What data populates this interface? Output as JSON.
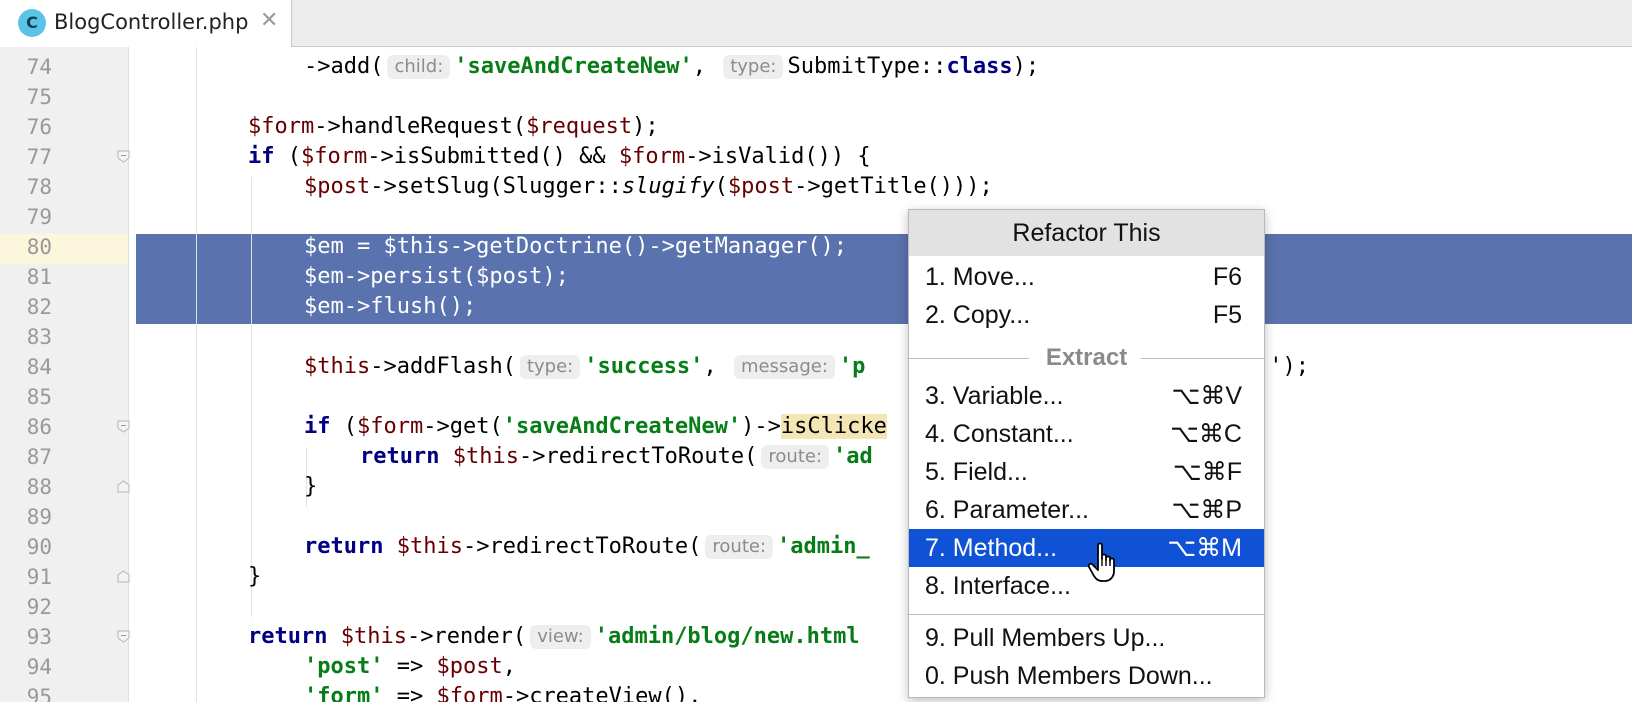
{
  "tab": {
    "icon_letter": "C",
    "filename": "BlogController.php",
    "close_glyph": "✕"
  },
  "gutter": {
    "line_numbers": [
      "74",
      "75",
      "76",
      "77",
      "78",
      "79",
      "80",
      "81",
      "82",
      "83",
      "84",
      "85",
      "86",
      "87",
      "88",
      "89",
      "90",
      "91",
      "92",
      "93",
      "94",
      "95"
    ]
  },
  "code": {
    "l74": {
      "a": "->add(",
      "hint1": "child:",
      "s1": "'saveAndCreateNew'",
      "b": ", ",
      "hint2": "type:",
      "c": "SubmitType::",
      "kw": "class",
      "d": ");"
    },
    "l76": {
      "v1": "$form",
      "a": "->handleRequest(",
      "v2": "$request",
      "b": ");"
    },
    "l77": {
      "kw": "if",
      "a": " (",
      "v1": "$form",
      "b": "->isSubmitted() && ",
      "v2": "$form",
      "c": "->isValid()) {"
    },
    "l78": {
      "v1": "$post",
      "a": "->setSlug(Slugger::",
      "it": "slugify",
      "b": "(",
      "v2": "$post",
      "c": "->getTitle()));"
    },
    "l80": {
      "t": "$em = $this->getDoctrine()->getManager();"
    },
    "l81": {
      "t": "$em->persist($post);"
    },
    "l82": {
      "t": "$em->flush();"
    },
    "l84": {
      "v1": "$this",
      "a": "->addFlash(",
      "hint1": "type:",
      "s1": "'success'",
      "b": ", ",
      "hint2": "message:",
      "s2": "'p",
      "tail": "');"
    },
    "l86": {
      "kw": "if",
      "a": " (",
      "v1": "$form",
      "b": "->get(",
      "s1": "'saveAndCreateNew'",
      "c": ")->",
      "hl": "isClicke"
    },
    "l87": {
      "kw": "return",
      "sp": " ",
      "v1": "$this",
      "a": "->redirectToRoute(",
      "hint": "route:",
      "s1": "'ad"
    },
    "l88": {
      "t": "}"
    },
    "l90": {
      "kw": "return",
      "sp": " ",
      "v1": "$this",
      "a": "->redirectToRoute(",
      "hint": "route:",
      "s1": "'admin_"
    },
    "l91": {
      "t": "}"
    },
    "l93": {
      "kw": "return",
      "sp": " ",
      "v1": "$this",
      "a": "->render(",
      "hint": "view:",
      "s1": "'admin/blog/new.html"
    },
    "l94": {
      "s1": "'post'",
      "a": " => ",
      "v1": "$post",
      "b": ","
    },
    "l95": {
      "s1": "'form'",
      "a": " => ",
      "v1": "$form",
      "b": "->createView(),"
    }
  },
  "popup": {
    "title": "Refactor This",
    "items_top": [
      {
        "label": "1. Move...",
        "shortcut": "F6"
      },
      {
        "label": "2. Copy...",
        "shortcut": "F5"
      }
    ],
    "section_label": "Extract",
    "items_extract": [
      {
        "label": "3. Variable...",
        "shortcut": "⌥⌘V"
      },
      {
        "label": "4. Constant...",
        "shortcut": "⌥⌘C"
      },
      {
        "label": "5. Field...",
        "shortcut": "⌥⌘F"
      },
      {
        "label": "6. Parameter...",
        "shortcut": "⌥⌘P"
      },
      {
        "label": "7. Method...",
        "shortcut": "⌥⌘M"
      },
      {
        "label": "8. Interface...",
        "shortcut": ""
      }
    ],
    "items_bottom": [
      {
        "label": "9. Pull Members Up...",
        "shortcut": ""
      },
      {
        "label": "0. Push Members Down...",
        "shortcut": ""
      }
    ],
    "selected_item": "7. Method..."
  },
  "colors": {
    "selection": "#5a72ad",
    "menu_selected": "#0f52d6",
    "keyword": "#000080",
    "string": "#067d17",
    "variable": "#660000"
  },
  "icons": {
    "tab_icon": "php-class-icon",
    "cursor": "hand-pointer-icon"
  }
}
